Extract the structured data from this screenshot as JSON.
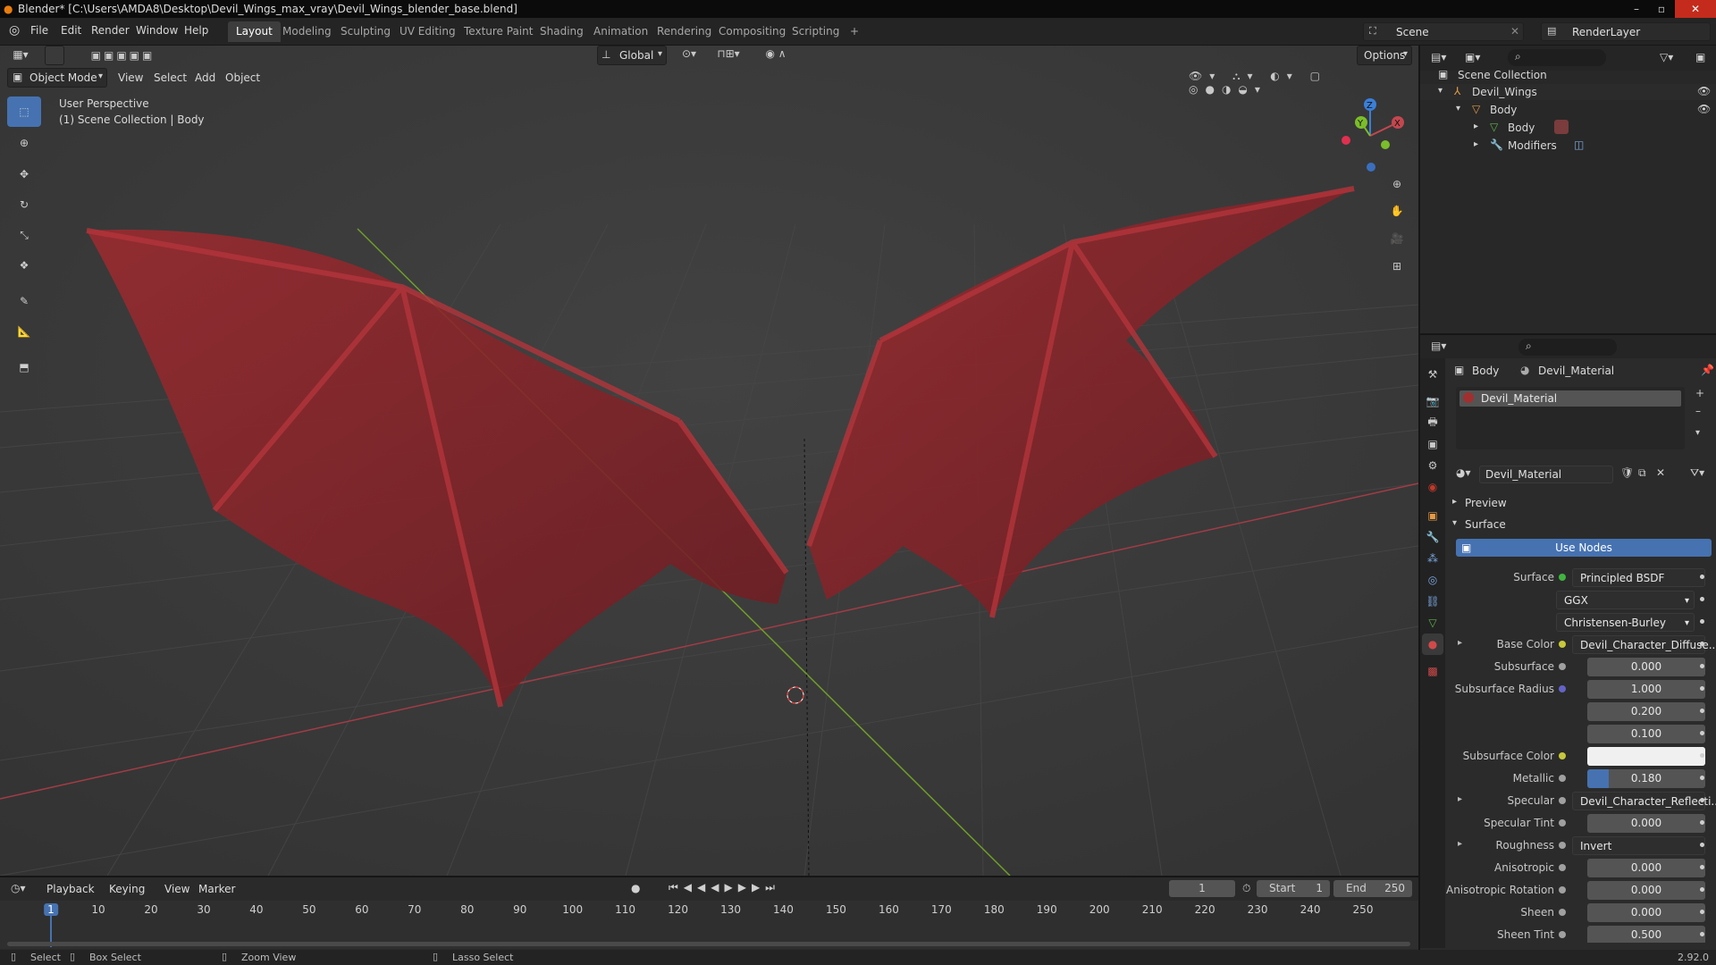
{
  "window": {
    "title": "Blender* [C:\\Users\\AMDA8\\Desktop\\Devil_Wings_max_vray\\Devil_Wings_blender_base.blend]"
  },
  "menu": [
    "File",
    "Edit",
    "Render",
    "Window",
    "Help"
  ],
  "workspaces": [
    "Layout",
    "Modeling",
    "Sculpting",
    "UV Editing",
    "Texture Paint",
    "Shading",
    "Animation",
    "Rendering",
    "Compositing",
    "Scripting"
  ],
  "active_workspace": "Layout",
  "scene": {
    "label": "Scene",
    "renderlayer": "RenderLayer"
  },
  "viewport": {
    "mode": "Object Mode",
    "menus": [
      "View",
      "Select",
      "Add",
      "Object"
    ],
    "orientation": "Global",
    "options": "Options",
    "info_line1": "User Perspective",
    "info_line2": "(1) Scene Collection | Body",
    "gizmo": {
      "x": "X",
      "y": "Y",
      "z": "Z"
    }
  },
  "outliner": {
    "root": "Scene Collection",
    "items": [
      {
        "label": "Devil_Wings",
        "depth": 1
      },
      {
        "label": "Body",
        "depth": 2
      },
      {
        "label": "Body",
        "depth": 3
      },
      {
        "label": "Modifiers",
        "depth": 3
      }
    ]
  },
  "properties": {
    "breadcrumb_object": "Body",
    "breadcrumb_material": "Devil_Material",
    "slot": "Devil_Material",
    "material_name": "Devil_Material",
    "sections": {
      "preview": "Preview",
      "surface": "Surface"
    },
    "use_nodes": "Use Nodes",
    "rows": [
      {
        "label": "Surface",
        "value": "Principled BSDF",
        "socket": "#3fb53f",
        "kind": "link"
      },
      {
        "label": "",
        "value": "GGX",
        "kind": "dropdown"
      },
      {
        "label": "",
        "value": "Christensen-Burley",
        "kind": "dropdown"
      },
      {
        "label": "Base Color",
        "value": "Devil_Character_Diffuse...",
        "socket": "#c8c83a",
        "kind": "link",
        "expand": true
      },
      {
        "label": "Subsurface",
        "value": "0.000",
        "socket": "#a0a0a0",
        "kind": "num"
      },
      {
        "label": "Subsurface Radius",
        "value": "1.000",
        "socket": "#6363c7",
        "kind": "num"
      },
      {
        "label": "",
        "value": "0.200",
        "kind": "num"
      },
      {
        "label": "",
        "value": "0.100",
        "kind": "num"
      },
      {
        "label": "Subsurface Color",
        "value": "",
        "socket": "#c8c83a",
        "kind": "color"
      },
      {
        "label": "Metallic",
        "value": "0.180",
        "socket": "#a0a0a0",
        "kind": "slider",
        "fill": 0.18
      },
      {
        "label": "Specular",
        "value": "Devil_Character_Reflecti...",
        "socket": "#a0a0a0",
        "kind": "link",
        "expand": true
      },
      {
        "label": "Specular Tint",
        "value": "0.000",
        "socket": "#a0a0a0",
        "kind": "num"
      },
      {
        "label": "Roughness",
        "value": "Invert",
        "socket": "#a0a0a0",
        "kind": "link",
        "expand": true
      },
      {
        "label": "Anisotropic",
        "value": "0.000",
        "socket": "#a0a0a0",
        "kind": "num"
      },
      {
        "label": "Anisotropic Rotation",
        "value": "0.000",
        "socket": "#a0a0a0",
        "kind": "num"
      },
      {
        "label": "Sheen",
        "value": "0.000",
        "socket": "#a0a0a0",
        "kind": "num"
      },
      {
        "label": "Sheen Tint",
        "value": "0.500",
        "socket": "#a0a0a0",
        "kind": "num"
      }
    ]
  },
  "timeline": {
    "menus": [
      "Playback",
      "Keying",
      "View",
      "Marker"
    ],
    "current": "1",
    "start_label": "Start",
    "start": "1",
    "end_label": "End",
    "end": "250",
    "ruler": [
      "1",
      "10",
      "20",
      "30",
      "40",
      "50",
      "60",
      "70",
      "80",
      "90",
      "100",
      "110",
      "120",
      "130",
      "140",
      "150",
      "160",
      "170",
      "180",
      "190",
      "200",
      "210",
      "220",
      "230",
      "240",
      "250"
    ]
  },
  "status": {
    "select": "Select",
    "box_select": "Box Select",
    "zoom_view": "Zoom View",
    "lasso_select": "Lasso Select",
    "version": "2.92.0"
  },
  "colors": {
    "accent": "#4672b1",
    "x_axis": "#c4474f",
    "y_axis": "#7bbd2a",
    "z_axis": "#3a7fd9",
    "wing": "#8e2a2e"
  }
}
